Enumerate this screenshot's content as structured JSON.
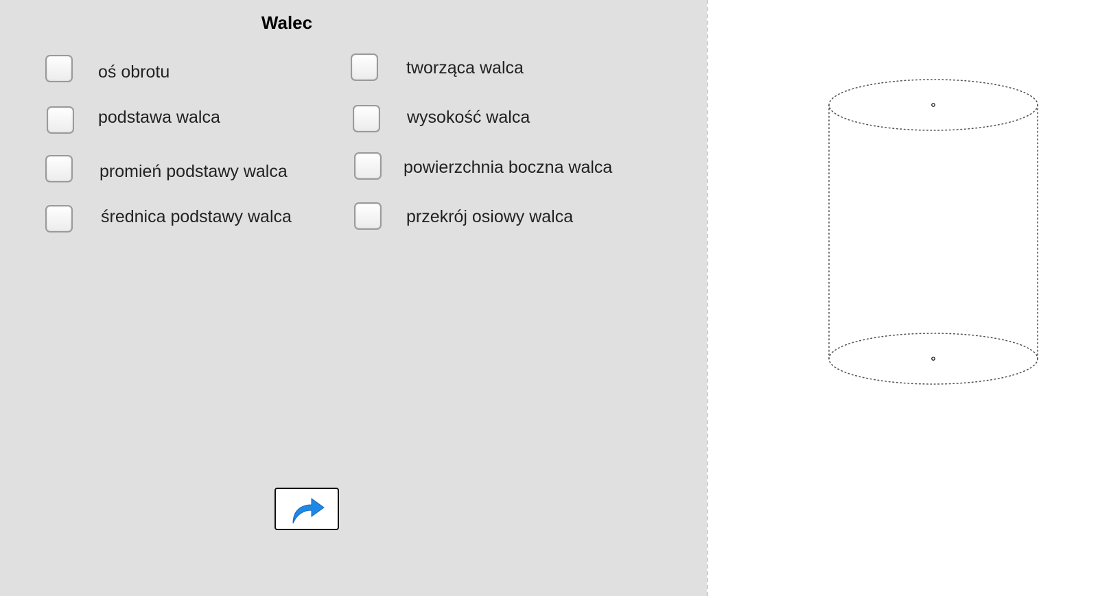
{
  "title": "Walec",
  "options_left": [
    {
      "label": "oś obrotu",
      "checked": false
    },
    {
      "label": "podstawa walca",
      "checked": false
    },
    {
      "label": "promień podstawy walca",
      "checked": false
    },
    {
      "label": "średnica podstawy walca",
      "checked": false
    }
  ],
  "options_right": [
    {
      "label": "tworząca walca",
      "checked": false
    },
    {
      "label": "wysokość walca",
      "checked": false
    },
    {
      "label": "powierzchnia boczna walca",
      "checked": false
    },
    {
      "label": "przekrój osiowy walca",
      "checked": false
    }
  ],
  "next_button_icon": "redo-arrow-icon",
  "colors": {
    "panel": "#e0e0e0",
    "arrow": "#1e88e5"
  }
}
